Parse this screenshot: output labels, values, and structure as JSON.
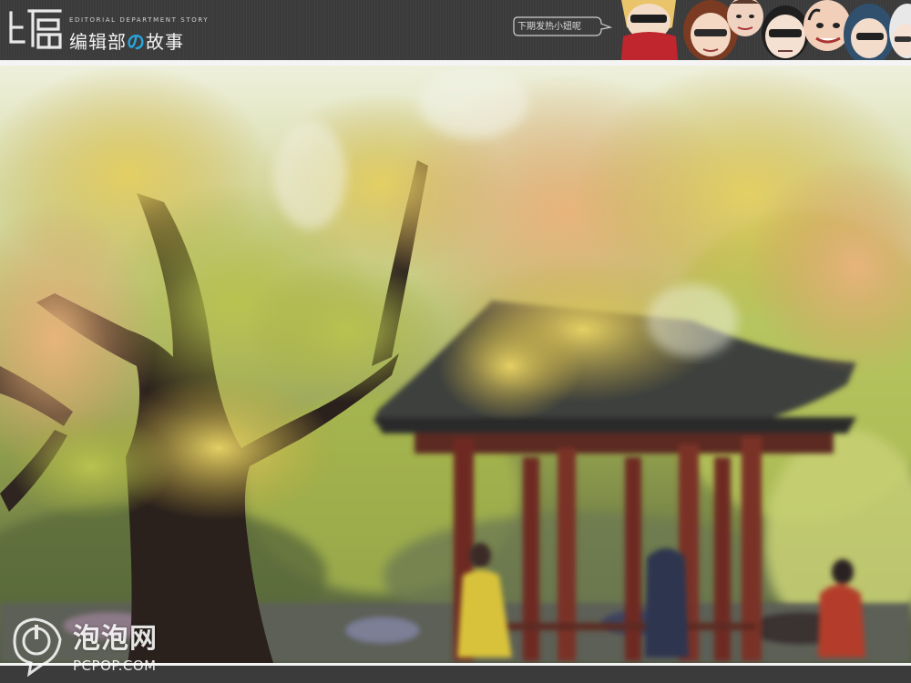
{
  "header": {
    "logo_char": "编",
    "brand_en": "EDITORIAL DEPARTMENT STORY",
    "brand_cn_pre": "编辑部",
    "brand_cn_no": "の",
    "brand_cn_post": "故事",
    "bubble_text": "下期发热小妞呢",
    "accent_color": "#27a7df"
  },
  "photo": {
    "scene": "autumn-maple-pavilion"
  },
  "watermark": {
    "cn": "泡泡网",
    "en": "PCPOP.COM",
    "icon": "power-icon"
  }
}
